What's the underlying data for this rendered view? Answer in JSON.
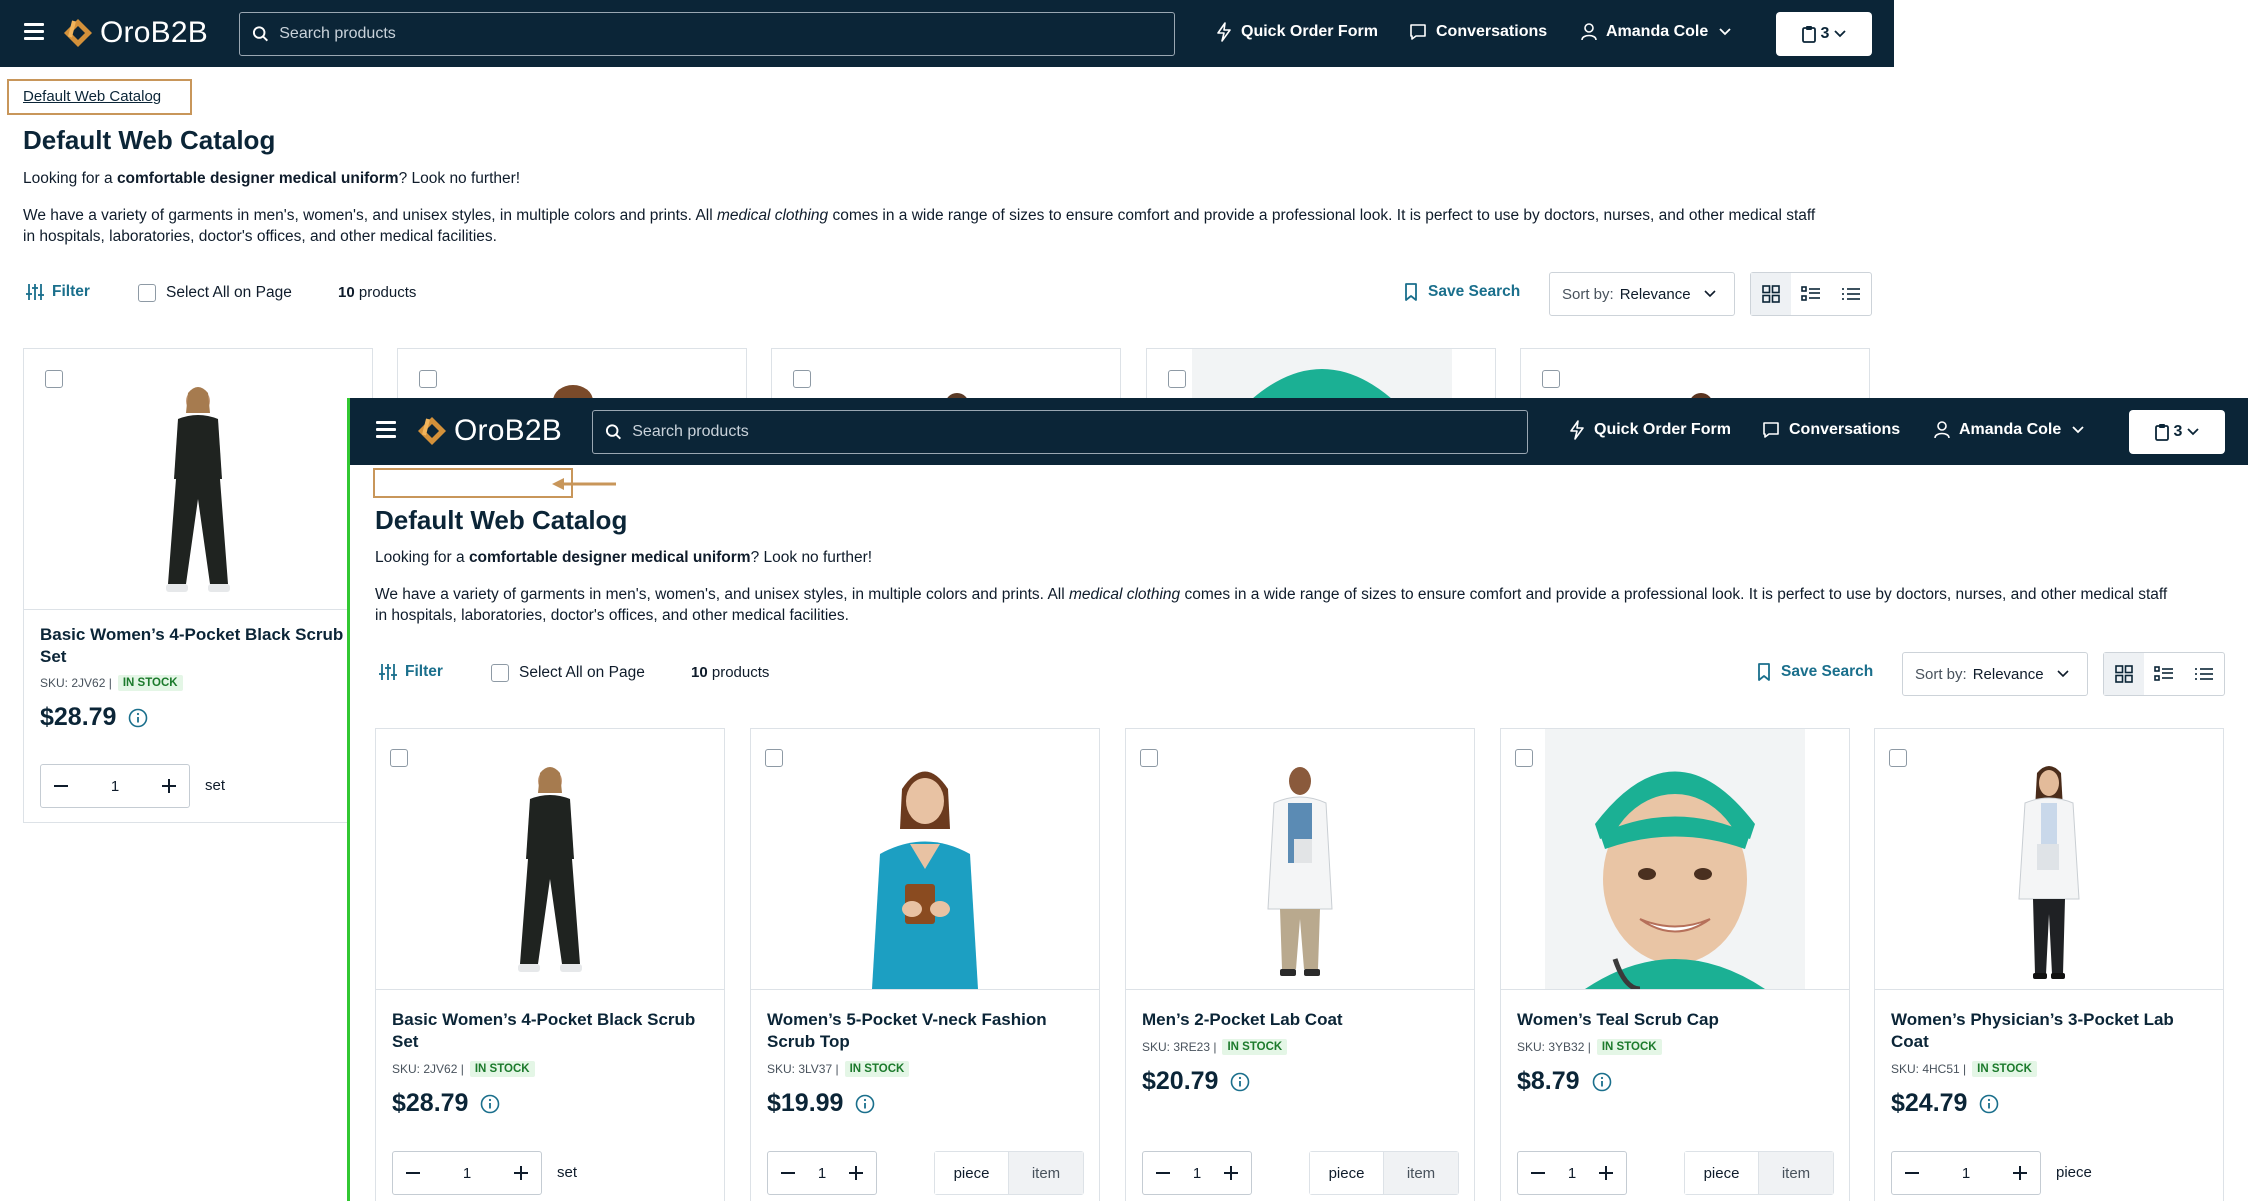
{
  "header": {
    "brand": "OroB2B",
    "search_placeholder": "Search products",
    "quick_order_label": "Quick Order Form",
    "conversations_label": "Conversations",
    "user_name": "Amanda Cole",
    "cart_count": "3"
  },
  "breadcrumb": {
    "label": "Default Web Catalog"
  },
  "page": {
    "title": "Default Web Catalog",
    "intro_before": "Looking for a ",
    "intro_bold": "comfortable designer medical uniform",
    "intro_after": "? Look no further!",
    "desc_1": "We have a variety of garments in men's, women's, and unisex styles, in multiple colors and prints. All ",
    "desc_italic": "medical clothing",
    "desc_2": " comes in a wide range of sizes to ensure comfort and provide a professional look. It is perfect to use by doctors, nurses, and other medical staff",
    "desc_3": "in hospitals, laboratories, doctor's offices, and other medical facilities."
  },
  "toolbar": {
    "filter_label": "Filter",
    "select_all_label": "Select All on Page",
    "product_count": "10",
    "product_count_label": "products",
    "save_search_label": "Save Search",
    "sort_prefix": "Sort by:",
    "sort_value": "Relevance"
  },
  "products": [
    {
      "name": "Basic Women’s 4-Pocket Black Scrub Set",
      "sku": "SKU: 2JV62 |",
      "stock": "IN STOCK",
      "price": "$28.79",
      "qty": "1",
      "unit": "set"
    },
    {
      "name": "Women’s 5-Pocket V-neck Fashion Scrub Top",
      "sku": "SKU: 3LV37 |",
      "stock": "IN STOCK",
      "price": "$19.99",
      "qty": "1",
      "unit_options": [
        "piece",
        "item"
      ]
    },
    {
      "name": "Men’s 2-Pocket Lab Coat",
      "sku": "SKU: 3RE23 |",
      "stock": "IN STOCK",
      "price": "$20.79",
      "qty": "1",
      "unit_options": [
        "piece",
        "item"
      ]
    },
    {
      "name": "Women’s Teal Scrub Cap",
      "sku": "SKU: 3YB32 |",
      "stock": "IN STOCK",
      "price": "$8.79",
      "qty": "1",
      "unit_options": [
        "piece",
        "item"
      ]
    },
    {
      "name": "Women’s Physician’s 3-Pocket Lab Coat",
      "sku": "SKU: 4HC51 |",
      "stock": "IN STOCK",
      "price": "$24.79",
      "qty": "1",
      "unit": "piece"
    }
  ],
  "icons": {
    "menu": "hamburger-menu-icon",
    "search": "search-icon",
    "quick_order": "lightning-icon",
    "conversations": "chat-bubble-icon",
    "user": "user-icon",
    "cart": "clipboard-icon",
    "filter": "sliders-icon",
    "save": "bookmark-icon",
    "info": "info-icon",
    "grid": "grid-view-icon",
    "list": "list-view-icon",
    "compact": "compact-list-icon"
  },
  "colors": {
    "header_bg": "#0b2537",
    "accent_link": "#1a6f8c",
    "brand_orange": "#d4913a",
    "highlight_box": "#c8965a",
    "stock_green": "#1c7a2c",
    "stock_bg": "#e4f6e6",
    "overlay_edge": "#32c832"
  }
}
